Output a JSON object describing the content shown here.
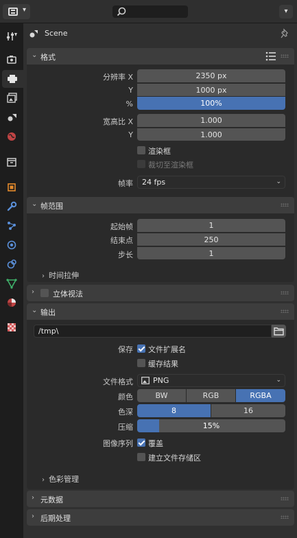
{
  "header": {
    "search_placeholder": ""
  },
  "scene": {
    "name": "Scene"
  },
  "panels": {
    "format": {
      "title": "格式",
      "resolution_x_label": "分辨率 X",
      "resolution_x": "2350 px",
      "resolution_y_label": "Y",
      "resolution_y": "1000 px",
      "percent_label": "%",
      "percent": "100%",
      "aspect_x_label": "宽高比 X",
      "aspect_x": "1.000",
      "aspect_y_label": "Y",
      "aspect_y": "1.000",
      "render_region_label": "渲染框",
      "render_region_checked": false,
      "crop_label": "裁切至渲染框",
      "crop_checked": false,
      "frame_rate_label": "帧率",
      "frame_rate": "24 fps"
    },
    "frame_range": {
      "title": "帧范围",
      "start_label": "起始帧",
      "start": "1",
      "end_label": "结束点",
      "end": "250",
      "step_label": "步长",
      "step": "1",
      "time_stretch_label": "时间拉伸"
    },
    "stereoscopy": {
      "title": "立体视法",
      "enabled": false
    },
    "output": {
      "title": "输出",
      "path": "/tmp\\",
      "save_label": "保存",
      "file_ext_label": "文件扩展名",
      "file_ext_checked": true,
      "cache_result_label": "缓存结果",
      "cache_result_checked": false,
      "file_format_label": "文件格式",
      "file_format": "PNG",
      "color_label": "颜色",
      "color_options": [
        "BW",
        "RGB",
        "RGBA"
      ],
      "color_selected": "RGBA",
      "depth_label": "色深",
      "depth_options": [
        "8",
        "16"
      ],
      "depth_selected": "8",
      "compression_label": "压缩",
      "compression": "15%",
      "compression_value": 0.15,
      "image_sequence_label": "图像序列",
      "overwrite_label": "覆盖",
      "overwrite_checked": true,
      "placeholders_label": "建立文件存储区",
      "placeholders_checked": false,
      "color_management_label": "色彩管理"
    },
    "metadata": {
      "title": "元数据"
    },
    "post_processing": {
      "title": "后期处理"
    }
  },
  "colors": {
    "accent": "#4772b3",
    "panel_header": "#3d3d3d",
    "field": "#545454"
  }
}
